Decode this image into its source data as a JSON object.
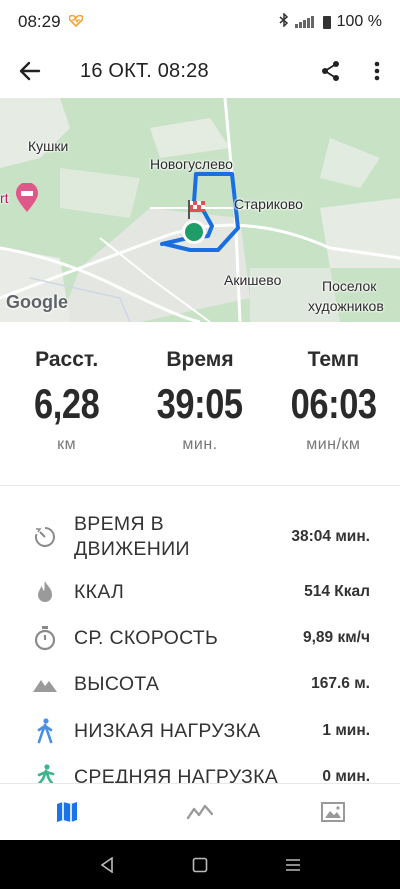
{
  "status_bar": {
    "time": "08:29",
    "battery": "100 %"
  },
  "app_bar": {
    "title": "16 ОКТ. 08:28"
  },
  "map": {
    "labels": {
      "kushki": "Кушки",
      "novogusl": "Новогуслево",
      "starikovo": "Стариково",
      "akishevo": "Акишево",
      "poselok_1": "Поселок",
      "poselok_2": "художников",
      "rt": "rt",
      "google": "Google"
    }
  },
  "stats": [
    {
      "label": "Расст.",
      "value": "6,28",
      "unit": "км"
    },
    {
      "label": "Время",
      "value": "39:05",
      "unit": "мин."
    },
    {
      "label": "Темп",
      "value": "06:03",
      "unit": "мин/км"
    }
  ],
  "details": [
    {
      "icon": "stopwatch-icon",
      "label_1": "ВРЕМЯ В",
      "label_2": "ДВИЖЕНИИ",
      "value": "38:04 мин."
    },
    {
      "icon": "flame-icon",
      "label": "ККАЛ",
      "value": "514 Ккал"
    },
    {
      "icon": "timer-icon",
      "label": "СР. СКОРОСТЬ",
      "value": "9,89 км/ч"
    },
    {
      "icon": "mountain-icon",
      "label": "ВЫСОТА",
      "value": "167.6 м."
    },
    {
      "icon": "walking-icon",
      "label": "НИЗКАЯ НАГРУЗКА",
      "value": "1 мин."
    },
    {
      "icon": "running-icon",
      "label": "СРЕДНЯЯ НАГРУЗКА",
      "value": "0 мин."
    }
  ],
  "colors": {
    "accent": "#1a73e8",
    "route": "#1a6fe0",
    "walk": "#4a90e2",
    "run": "#3ab68a"
  }
}
